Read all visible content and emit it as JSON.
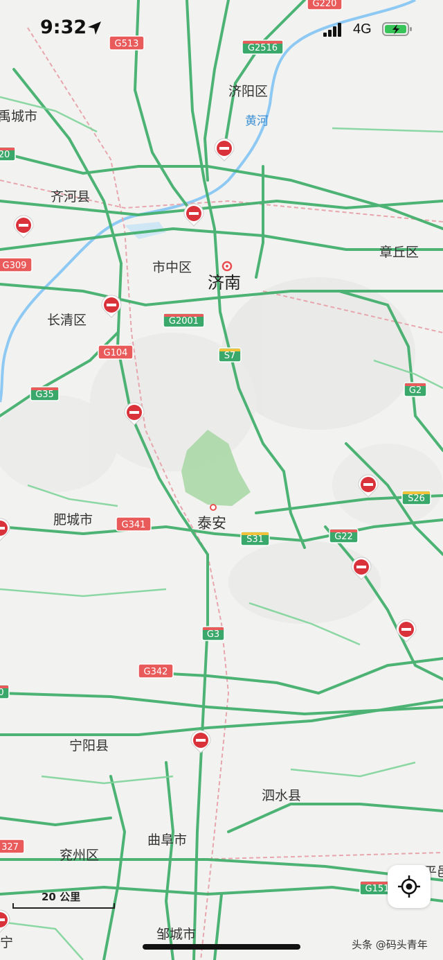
{
  "status_bar": {
    "time": "9:32",
    "network": "4G",
    "icons": [
      "location-arrow-icon",
      "signal-bars-icon",
      "battery-charging-icon"
    ]
  },
  "colors": {
    "road_green": "#3fae6a",
    "road_green_light": "#7fd49a",
    "water": "#8ec9f4",
    "land": "#f2f2f0",
    "park": "#a7d7a3",
    "national_shield": "#e95b5b",
    "provincial_shield": "#3aa86a",
    "rail": "#e7a6ad"
  },
  "map": {
    "places": [
      {
        "id": "jiyang",
        "label": "济阳区"
      },
      {
        "id": "yucheng",
        "label": "禹城市"
      },
      {
        "id": "qihe",
        "label": "齐河县"
      },
      {
        "id": "shizhong",
        "label": "市中区"
      },
      {
        "id": "jinan",
        "label": "济南"
      },
      {
        "id": "zhangqiu",
        "label": "章丘区"
      },
      {
        "id": "changqing",
        "label": "长清区"
      },
      {
        "id": "feicheng",
        "label": "肥城市"
      },
      {
        "id": "taian",
        "label": "泰安"
      },
      {
        "id": "ningyang",
        "label": "宁阳县"
      },
      {
        "id": "sishui",
        "label": "泗水县"
      },
      {
        "id": "qufu",
        "label": "曲阜市"
      },
      {
        "id": "yanzhou",
        "label": "兖州区"
      },
      {
        "id": "zoucheng",
        "label": "邹城市"
      },
      {
        "id": "ning_partial",
        "label": "宁"
      },
      {
        "id": "yi_partial",
        "label": "平邑"
      }
    ],
    "river_label": "黄河",
    "highways": [
      {
        "id": "g513",
        "label": "G513",
        "kind": "national"
      },
      {
        "id": "g2516",
        "label": "G2516",
        "kind": "expressway"
      },
      {
        "id": "g220",
        "label": "G220",
        "kind": "national"
      },
      {
        "id": "x20",
        "label": "20",
        "kind": "expressway"
      },
      {
        "id": "g309",
        "label": "G309",
        "kind": "national"
      },
      {
        "id": "g2001",
        "label": "G2001",
        "kind": "expressway"
      },
      {
        "id": "g104",
        "label": "G104",
        "kind": "national"
      },
      {
        "id": "s7",
        "label": "S7",
        "kind": "provincial"
      },
      {
        "id": "g35",
        "label": "G35",
        "kind": "expressway"
      },
      {
        "id": "g2",
        "label": "G2",
        "kind": "expressway"
      },
      {
        "id": "s26",
        "label": "S26",
        "kind": "provincial"
      },
      {
        "id": "g341",
        "label": "G341",
        "kind": "national"
      },
      {
        "id": "s31",
        "label": "S31",
        "kind": "provincial"
      },
      {
        "id": "g22",
        "label": "G22",
        "kind": "expressway"
      },
      {
        "id": "g3",
        "label": "G3",
        "kind": "expressway"
      },
      {
        "id": "g342",
        "label": "G342",
        "kind": "national"
      },
      {
        "id": "x0",
        "label": "0",
        "kind": "expressway"
      },
      {
        "id": "g327",
        "label": "327",
        "kind": "national"
      },
      {
        "id": "g151",
        "label": "G151",
        "kind": "expressway"
      }
    ],
    "closure_markers": 11,
    "scale_label": "20 公里"
  },
  "watermark": "头条 @码头青年"
}
